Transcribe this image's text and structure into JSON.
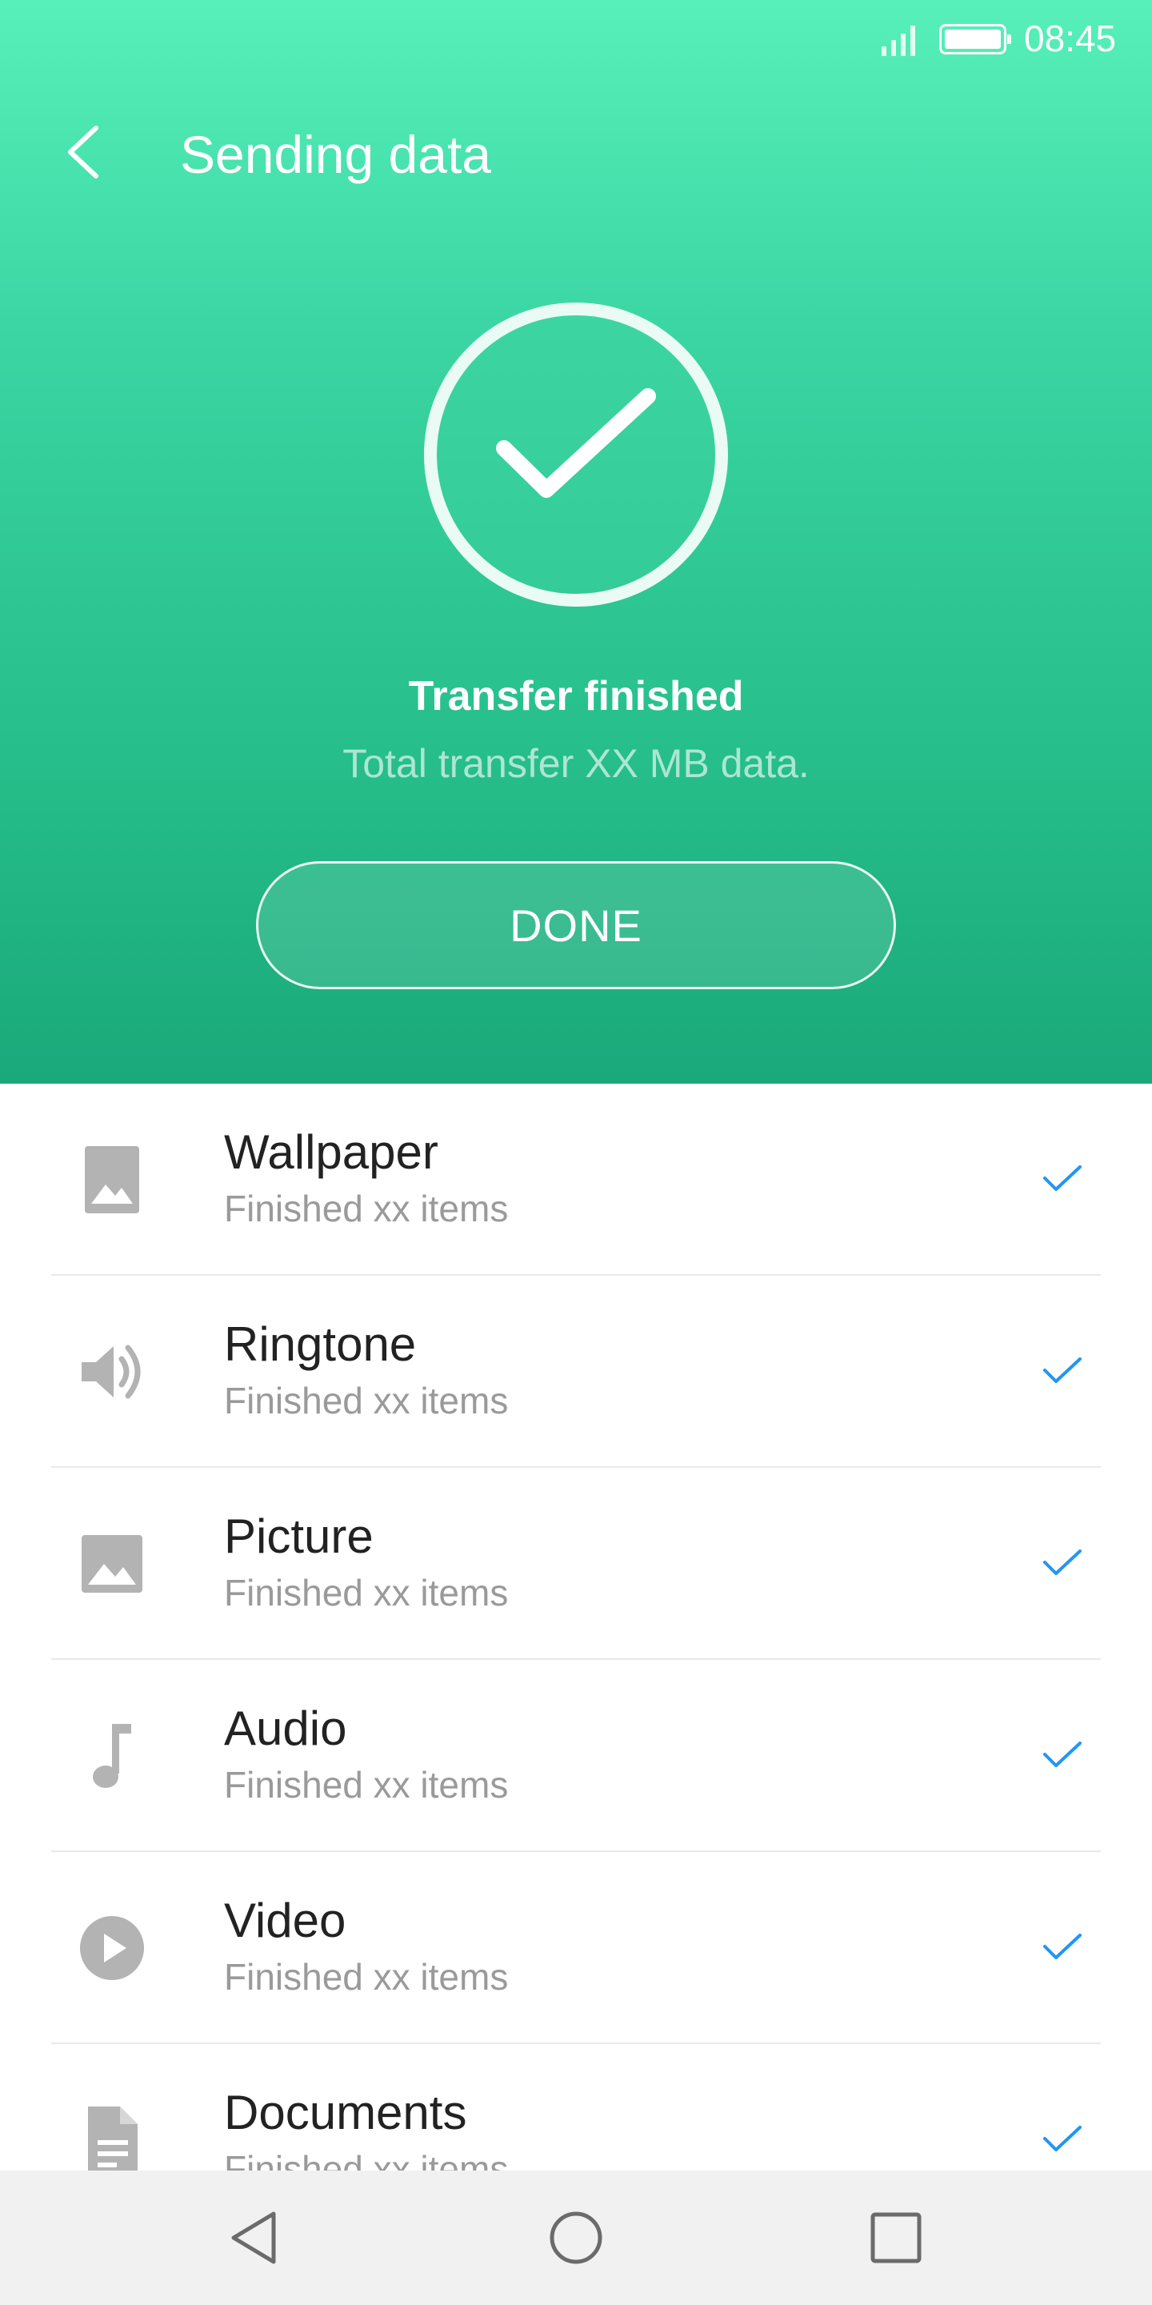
{
  "status_bar": {
    "time": "08:45",
    "signal_icon": "signal-icon",
    "battery_icon": "battery-icon"
  },
  "header": {
    "title": "Sending data",
    "back_icon": "chevron-left-icon"
  },
  "result": {
    "icon": "check-circle-icon",
    "title": "Transfer finished",
    "subtitle": "Total transfer XX MB data.",
    "done_label": "DONE"
  },
  "items": [
    {
      "label": "Wallpaper",
      "status": "Finished xx items",
      "icon": "wallpaper-icon"
    },
    {
      "label": "Ringtone",
      "status": "Finished xx items",
      "icon": "speaker-icon"
    },
    {
      "label": "Picture",
      "status": "Finished xx items",
      "icon": "picture-icon"
    },
    {
      "label": "Audio",
      "status": "Finished xx items",
      "icon": "music-note-icon"
    },
    {
      "label": "Video",
      "status": "Finished xx items",
      "icon": "play-icon"
    },
    {
      "label": "Documents",
      "status": "Finished xx items",
      "icon": "document-icon"
    }
  ],
  "nav": {
    "back_icon": "nav-back-icon",
    "home_icon": "nav-home-icon",
    "recents_icon": "nav-recents-icon"
  },
  "colors": {
    "gradient_top": "#57f0ba",
    "gradient_bottom": "#1aa97a",
    "check_blue": "#2196f3",
    "icon_gray": "#b3b3b3"
  }
}
